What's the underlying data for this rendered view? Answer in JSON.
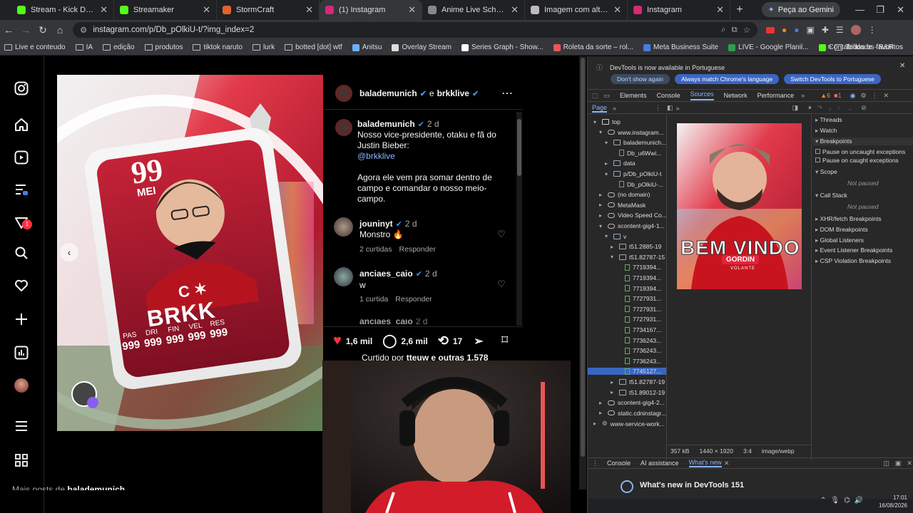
{
  "browser": {
    "tabs": [
      {
        "title": "Stream - Kick Dashboard",
        "color": "#53fc18"
      },
      {
        "title": "Streamaker",
        "color": "#53fc18"
      },
      {
        "title": "StormCraft",
        "color": "#e0632f"
      },
      {
        "title": "(1) Instagram",
        "color": "#d62976",
        "active": true
      },
      {
        "title": "Anime Live Schedule",
        "color": "#888888"
      },
      {
        "title": "Imagem com alterações",
        "color": "#bbbbbb"
      },
      {
        "title": "Instagram",
        "color": "#d62976"
      }
    ],
    "gemini_label": "Peça ao Gemini",
    "url": "instagram.com/p/Db_pOlkiU-t/?img_index=2",
    "bookmarks": [
      "Live e conteudo",
      "IA",
      "edição",
      "produtos",
      "tiktok naruto",
      "lurk",
      "botted [dot] wtf",
      "Anitsu",
      "Overlay Stream",
      "Series Graph - Show...",
      "Roleta da sorte – rol...",
      "Meta Business Suite",
      "LIVE - Google Planil...",
      "Contabilidade - R&R"
    ],
    "bookmarks_all": "Todos os favoritos"
  },
  "instagram": {
    "nav_icons": [
      "instagram-logo-icon",
      "home-icon",
      "reels-icon",
      "threads-icon",
      "messages-icon",
      "search-icon",
      "heart-icon",
      "create-icon",
      "dashboard-icon",
      "profile-avatar",
      "menu-icon",
      "apps-icon"
    ],
    "notif_count": "1",
    "post": {
      "header_user": "balademunich",
      "header_and": "e",
      "header_collab": "brkklive",
      "caption_user": "balademunich",
      "caption_time": "2 d",
      "caption_lines": [
        "Nosso vice-presidente, otaku e fã do",
        "Justin Bieber:"
      ],
      "caption_mention": "@brkklive",
      "caption_more": [
        "Agora ele vem pra somar dentro de",
        "campo e comandar o nosso meio-",
        "campo."
      ],
      "comments": [
        {
          "user": "jouninyt",
          "time": "2 d",
          "text": "Monstro 🔥",
          "likes": "2 curtidas",
          "reply": "Responder"
        },
        {
          "user": "anciaes_caio",
          "time": "2 d",
          "text": "w",
          "likes": "1 curtida",
          "reply": "Responder"
        },
        {
          "user": "anciaes_caio",
          "time": "2 d"
        }
      ],
      "likes_count": "1,6 mil",
      "comments_count": "2,6 mil",
      "shares_count": "17",
      "liked_by_prefix": "Curtido por",
      "liked_by_user": "tteuw",
      "liked_by_suffix": "e outras 1.578",
      "more_posts_prefix": "Mais posts de",
      "more_posts_user": "balademunich"
    },
    "card": {
      "rating": "99",
      "position": "MEI",
      "name": "BRKK",
      "stats": [
        {
          "label": "PAS",
          "value": "999"
        },
        {
          "label": "DRI",
          "value": "999"
        },
        {
          "label": "FIN",
          "value": "999"
        },
        {
          "label": "VEL",
          "value": "999"
        },
        {
          "label": "RES",
          "value": "999"
        }
      ],
      "crest": "C"
    }
  },
  "devtools": {
    "banner_text": "DevTools is now available in Portuguese",
    "btn_dont_show": "Don't show again",
    "btn_match": "Always match Chrome's language",
    "btn_switch": "Switch DevTools to Portuguese",
    "tabs": [
      "Elements",
      "Console",
      "Sources",
      "Network",
      "Performance"
    ],
    "active_tab": "Sources",
    "warn_count": "6",
    "err_count": "1",
    "sub_tab": "Page",
    "tree": [
      {
        "label": "top",
        "indent": 0,
        "kind": "frame"
      },
      {
        "label": "www.instagram...",
        "indent": 1,
        "kind": "cloud"
      },
      {
        "label": "balademunich...",
        "indent": 2,
        "kind": "folder"
      },
      {
        "label": "Db_u6Wwi...",
        "indent": 3,
        "kind": "file"
      },
      {
        "label": "data",
        "indent": 2,
        "kind": "folder"
      },
      {
        "label": "p/Db_pOlkiU-t",
        "indent": 2,
        "kind": "folder"
      },
      {
        "label": "Db_pOlkiU-...",
        "indent": 3,
        "kind": "file"
      },
      {
        "label": "(no domain)",
        "indent": 1,
        "kind": "cloud"
      },
      {
        "label": "MetaMask",
        "indent": 1,
        "kind": "cloud"
      },
      {
        "label": "Video Speed Co...",
        "indent": 1,
        "kind": "cloud"
      },
      {
        "label": "scontent-gig4-1...",
        "indent": 1,
        "kind": "cloud"
      },
      {
        "label": "v",
        "indent": 2,
        "kind": "folder"
      },
      {
        "label": "t51.2885-19",
        "indent": 3,
        "kind": "folder"
      },
      {
        "label": "t51.82787-15",
        "indent": 3,
        "kind": "folder"
      },
      {
        "label": "7719394...",
        "indent": 4,
        "kind": "file"
      },
      {
        "label": "7719394...",
        "indent": 4,
        "kind": "file"
      },
      {
        "label": "7719394...",
        "indent": 4,
        "kind": "file"
      },
      {
        "label": "7727931...",
        "indent": 4,
        "kind": "file"
      },
      {
        "label": "7727931...",
        "indent": 4,
        "kind": "file"
      },
      {
        "label": "7727931...",
        "indent": 4,
        "kind": "file"
      },
      {
        "label": "7734167...",
        "indent": 4,
        "kind": "file"
      },
      {
        "label": "7736243...",
        "indent": 4,
        "kind": "file"
      },
      {
        "label": "7736243...",
        "indent": 4,
        "kind": "file"
      },
      {
        "label": "7736243...",
        "indent": 4,
        "kind": "file"
      },
      {
        "label": "7745127...",
        "indent": 4,
        "kind": "file",
        "selected": true
      },
      {
        "label": "t51.82787-19",
        "indent": 3,
        "kind": "folder"
      },
      {
        "label": "t51.89012-19",
        "indent": 3,
        "kind": "folder"
      },
      {
        "label": "scontent-gig4-2...",
        "indent": 1,
        "kind": "cloud"
      },
      {
        "label": "static.cdninstagr...",
        "indent": 1,
        "kind": "cloud"
      },
      {
        "label": "www-service-work...",
        "indent": 0,
        "kind": "gear"
      }
    ],
    "preview_title_big": "BEM VINDO",
    "preview_title_small": "GORDIN",
    "preview_sub": "VOLANTE",
    "file_size": "357 kB",
    "dimensions": "1440 × 1920",
    "ratio": "3:4",
    "mime": "image/webp",
    "debugger": {
      "threads": "Threads",
      "watch": "Watch",
      "breakpoints": "Breakpoints",
      "pause_uncaught": "Pause on uncaught exceptions",
      "pause_caught": "Pause on caught exceptions",
      "scope": "Scope",
      "not_paused": "Not paused",
      "call_stack": "Call Stack",
      "not_paused2": "Not paused",
      "xhr": "XHR/fetch Breakpoints",
      "dom": "DOM Breakpoints",
      "global": "Global Listeners",
      "event": "Event Listener Breakpoints",
      "csp": "CSP Violation Breakpoints"
    },
    "drawer_tabs": [
      "Console",
      "AI assistance",
      "What's new"
    ],
    "whats_new": "What's new in DevTools 151"
  },
  "taskbar": {
    "time": "17:01",
    "date": "16/08/2026"
  }
}
